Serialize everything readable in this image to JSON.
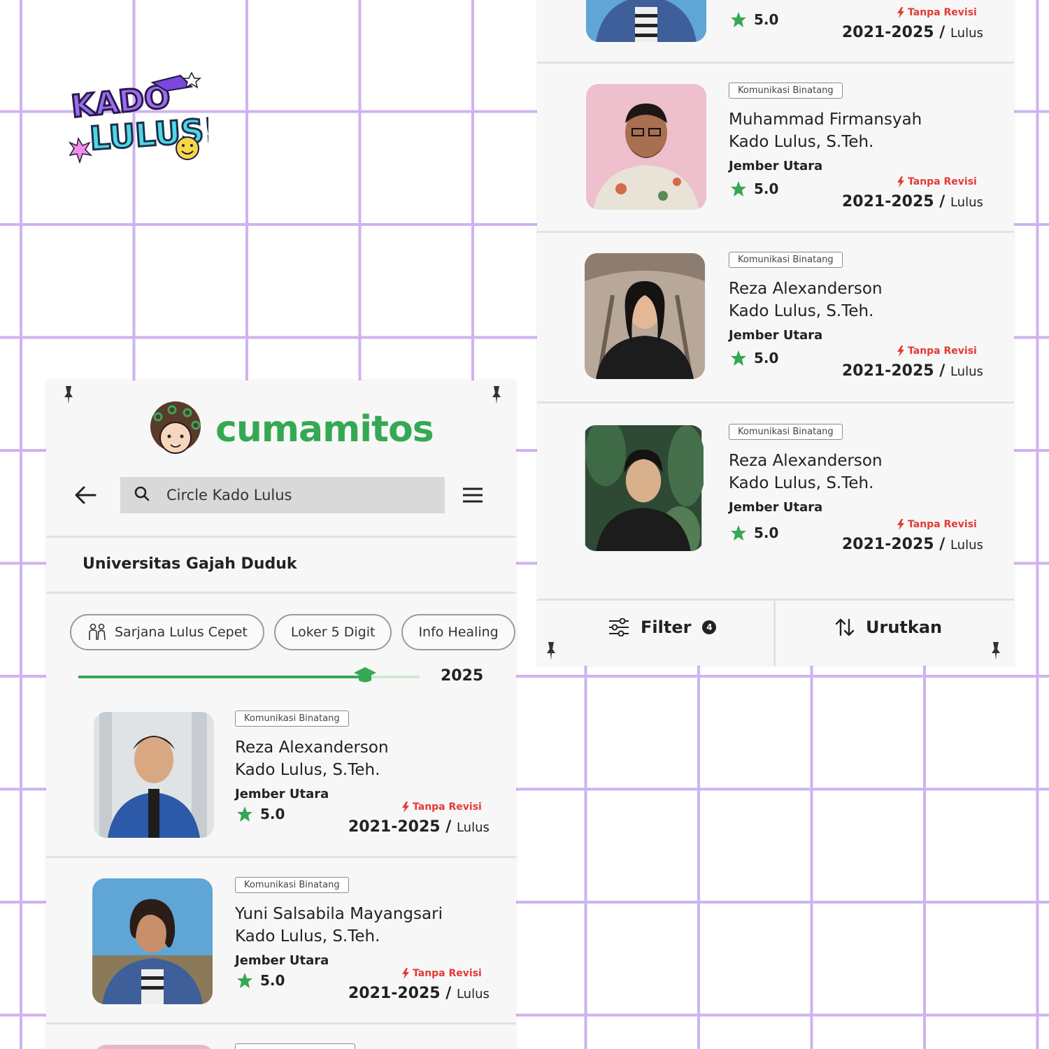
{
  "app": {
    "name": "cumamitos"
  },
  "search": {
    "value": "Circle Kado Lulus"
  },
  "university": "Universitas Gajah Duduk",
  "chips": [
    "Sarjana Lulus Cepet",
    "Loker 5 Digit",
    "Info Healing"
  ],
  "slider": {
    "year": "2025",
    "progress": 0.84
  },
  "colors": {
    "accent": "#35a853",
    "grid": "#cfb3ef",
    "revisi": "#e53935"
  },
  "cards_left": [
    {
      "tag": "Komunikasi Binatang",
      "name_line1": "Reza Alexanderson",
      "name_line2": "Kado Lulus, S.Teh.",
      "location": "Jember Utara",
      "rating": "5.0",
      "revisi": "Tanpa Revisi",
      "years": "2021-2025",
      "status": "Lulus"
    },
    {
      "tag": "Komunikasi Binatang",
      "name_line1": "Yuni Salsabila Mayangsari",
      "name_line2": "Kado Lulus, S.Teh.",
      "location": "Jember Utara",
      "rating": "5.0",
      "revisi": "Tanpa Revisi",
      "years": "2021-2025",
      "status": "Lulus"
    }
  ],
  "cards_right": [
    {
      "tag": "",
      "name_line1": "",
      "name_line2": "",
      "location": "Jember Utara",
      "rating": "5.0",
      "revisi": "Tanpa Revisi",
      "years": "2021-2025",
      "status": "Lulus"
    },
    {
      "tag": "Komunikasi Binatang",
      "name_line1": "Muhammad Firmansyah",
      "name_line2": "Kado Lulus, S.Teh.",
      "location": "Jember Utara",
      "rating": "5.0",
      "revisi": "Tanpa Revisi",
      "years": "2021-2025",
      "status": "Lulus"
    },
    {
      "tag": "Komunikasi Binatang",
      "name_line1": "Reza Alexanderson",
      "name_line2": "Kado Lulus, S.Teh.",
      "location": "Jember Utara",
      "rating": "5.0",
      "revisi": "Tanpa Revisi",
      "years": "2021-2025",
      "status": "Lulus"
    },
    {
      "tag": "Komunikasi Binatang",
      "name_line1": "Reza Alexanderson",
      "name_line2": "Kado Lulus, S.Teh.",
      "location": "Jember Utara",
      "rating": "5.0",
      "revisi": "Tanpa Revisi",
      "years": "2021-2025",
      "status": "Lulus"
    }
  ],
  "bottom_bar": {
    "filter_label": "Filter",
    "filter_count": "4",
    "sort_label": "Urutkan"
  },
  "icons": [
    "kado-lulus-logo",
    "arrow-left-icon",
    "search-icon",
    "hamburger-menu-icon",
    "people-icon",
    "graduation-cap-icon",
    "star-icon",
    "lightning-icon",
    "filter-sliders-icon",
    "sort-arrows-icon",
    "pushpin-icon"
  ]
}
